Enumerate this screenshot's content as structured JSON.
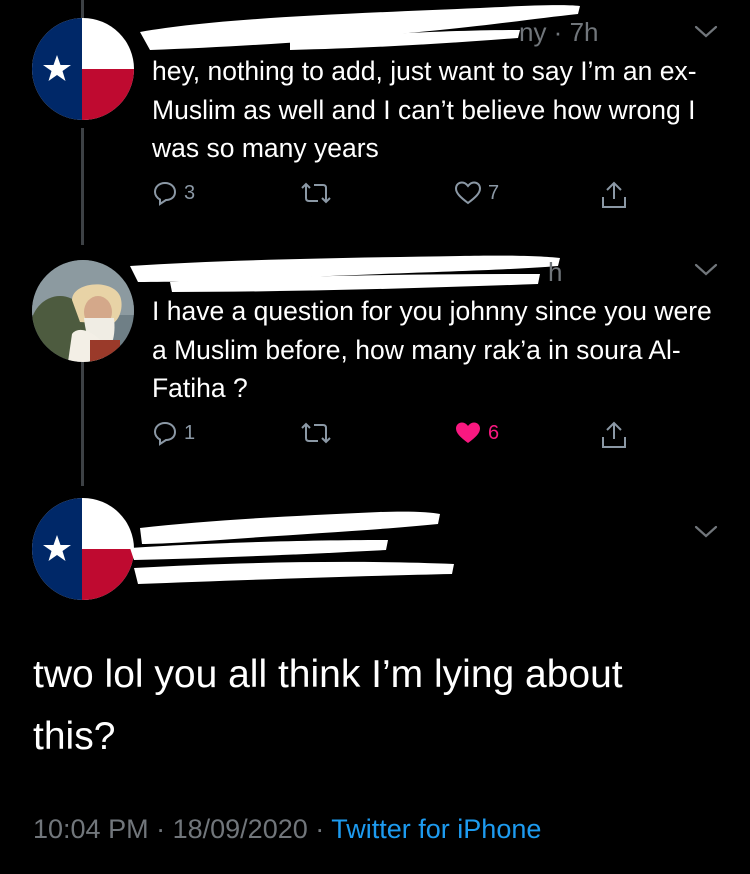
{
  "reply1": {
    "time_fragment": "ny · 7h",
    "text": "hey, nothing to add, just want to say I’m an ex-Muslim as well and I can’t believe how wrong I was so many years",
    "replies": "3",
    "retweets": "",
    "likes": "7",
    "avatar": "texas-flag"
  },
  "reply2": {
    "time_fragment": "h",
    "text": "I have a question for you johnny since you were a Muslim before, how many rak’a in soura Al-Fatiha ?",
    "replies": "1",
    "retweets": "",
    "likes": "6",
    "liked": true,
    "avatar": "old-man-portrait",
    "like_color": "#f91880"
  },
  "main_tweet": {
    "text": "two lol you all think I’m lying about this?",
    "time": "10:04 PM",
    "date": "18/09/2020",
    "source": "Twitter for iPhone",
    "separator": "·",
    "avatar": "texas-flag"
  },
  "colors": {
    "background": "#000000",
    "muted": "#71767b",
    "link": "#1d9bf0",
    "like": "#f91880"
  }
}
